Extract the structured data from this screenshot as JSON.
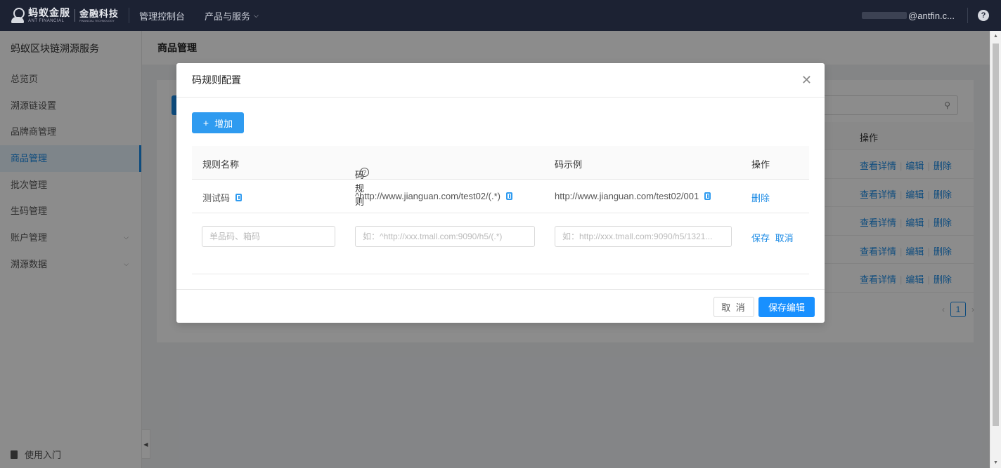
{
  "topbar": {
    "logo_cn": "蚂蚁金服",
    "logo_en": "ANT FINANCIAL",
    "fin_cn": "金融科技",
    "fin_en": "FINANCIAL TECHNOLOGY",
    "nav_console": "管理控制台",
    "nav_products": "产品与服务",
    "user_email": "@antfin.c...",
    "help": "?"
  },
  "sidebar": {
    "title": "蚂蚁区块链溯源服务",
    "items": [
      {
        "label": "总览页"
      },
      {
        "label": "溯源链设置"
      },
      {
        "label": "品牌商管理"
      },
      {
        "label": "商品管理"
      },
      {
        "label": "批次管理"
      },
      {
        "label": "生码管理"
      },
      {
        "label": "账户管理"
      },
      {
        "label": "溯源数据"
      }
    ],
    "footer": "使用入门"
  },
  "page": {
    "title": "商品管理",
    "table_header_action": "操作",
    "row_actions": {
      "detail": "查看详情",
      "edit": "编辑",
      "delete": "删除"
    },
    "current_page": "1"
  },
  "modal": {
    "title": "码规则配置",
    "add_button": "增加",
    "columns": {
      "name": "规则名称",
      "rule": "码规则",
      "example": "码示例",
      "action": "操作"
    },
    "rows": [
      {
        "name": "测试码",
        "rule": "^http://www.jianguan.com/test02/(.*)",
        "example": "http://www.jianguan.com/test02/001",
        "action": "删除"
      }
    ],
    "edit_row": {
      "name_placeholder": "单品码、箱码",
      "rule_placeholder": "如：^http://xxx.tmall.com:9090/h5/(.*)",
      "example_placeholder": "如：http://xxx.tmall.com:9090/h5/1321...",
      "save": "保存",
      "cancel": "取消"
    },
    "footer": {
      "cancel": "取 消",
      "save": "保存编辑"
    }
  },
  "colors": {
    "accent": "#1a8ae5",
    "topbar": "#1c2233",
    "primary_button": "#1890ff"
  }
}
